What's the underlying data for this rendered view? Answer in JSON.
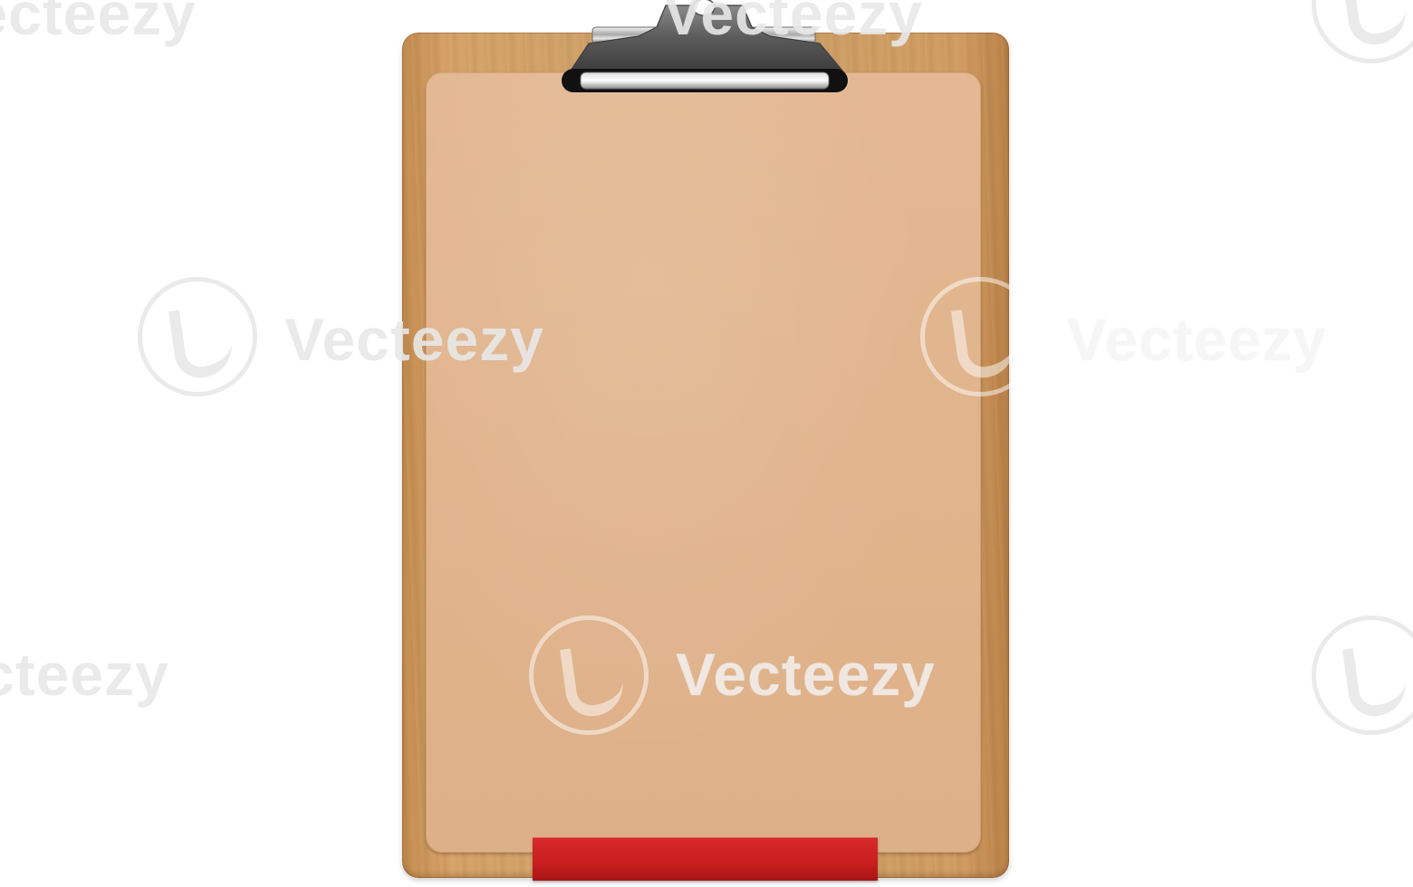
{
  "scene": {
    "subject": "clipboard",
    "colors": {
      "background": "#ffffff",
      "board_wood": "#d09c60",
      "paper": "#e0b48c",
      "tab_red": "#c81e1e",
      "clip_metal": "#9a9a9a"
    }
  },
  "watermark": {
    "brand": "Vecteezy",
    "partial_text": "Vecteezy",
    "icon": "vecteezy-logo-icon"
  }
}
